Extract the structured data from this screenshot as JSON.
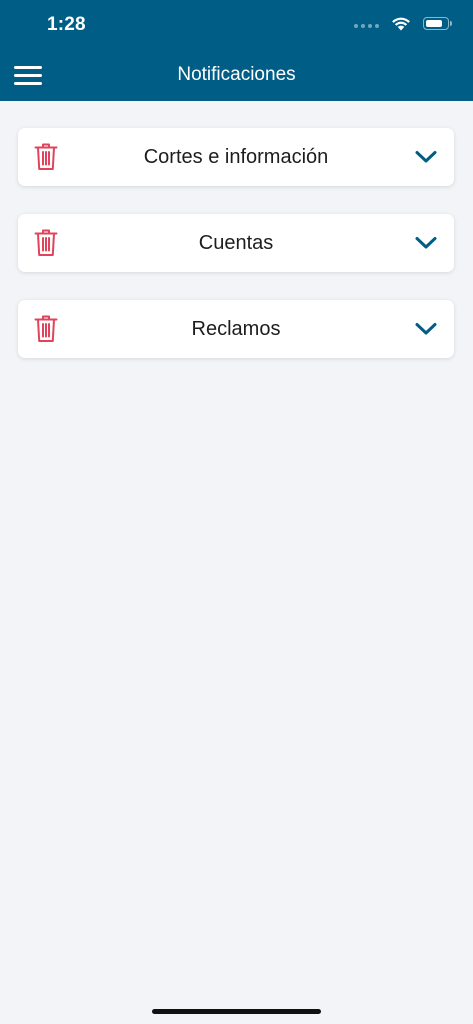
{
  "status_bar": {
    "time": "1:28",
    "battery_level": 0.85
  },
  "header": {
    "title": "Notificaciones"
  },
  "notifications": [
    {
      "label": "Cortes e información"
    },
    {
      "label": "Cuentas"
    },
    {
      "label": "Reclamos"
    }
  ],
  "colors": {
    "header_bg": "#005e86",
    "background": "#f2f4f8",
    "trash_icon": "#e0445a",
    "chevron_icon": "#005e86"
  },
  "icons": {
    "menu": "hamburger-menu-icon",
    "delete": "trash-icon",
    "expand": "chevron-down-icon",
    "wifi": "wifi-icon",
    "battery": "battery-icon",
    "signal": "signal-icon"
  }
}
